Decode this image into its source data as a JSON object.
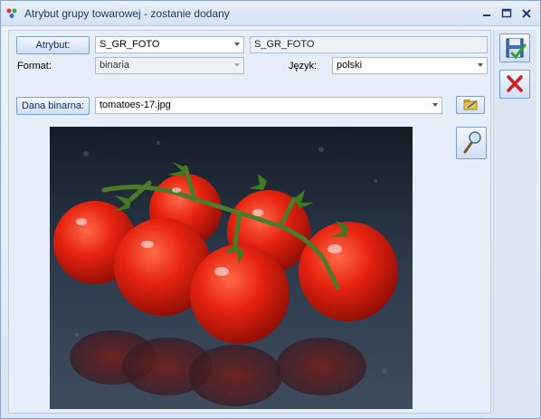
{
  "window": {
    "title": "Atrybut grupy towarowej - zostanie dodany"
  },
  "form": {
    "attribute_button": "Atrybut:",
    "attribute_code": "S_GR_FOTO",
    "attribute_name": "S_GR_FOTO",
    "format_label": "Format:",
    "format_value": "binaria",
    "language_label": "Język:",
    "language_value": "polski",
    "binary_button": "Dana binarna:",
    "binary_value": "tomatoes-17.jpg"
  },
  "icons": {
    "app": "app-icon",
    "minimize": "minimize-icon",
    "maximize": "maximize-icon",
    "close": "close-icon",
    "save": "save-icon",
    "cancel": "cancel-icon",
    "edit_file": "folder-edit-icon",
    "preview": "magnifier-icon"
  },
  "image": {
    "subject": "cherry-tomatoes-on-vine-photo"
  }
}
